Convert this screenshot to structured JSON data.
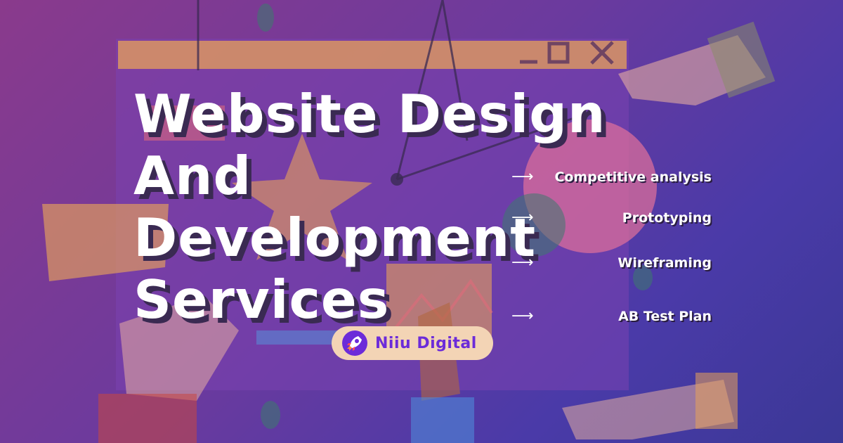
{
  "hero": {
    "title_lines": [
      "Website Design",
      "And",
      "Development",
      "Services"
    ]
  },
  "services": {
    "arrow_icon": "right-arrow-icon",
    "items": [
      {
        "label": "Competitive analysis"
      },
      {
        "label": "Prototyping"
      },
      {
        "label": "Wireframing"
      },
      {
        "label": "AB Test Plan"
      }
    ]
  },
  "brand": {
    "name": "Niiu Digital",
    "logo_icon": "rocket-icon",
    "accent_color": "#6c2bd9",
    "pill_color": "#f3d4b5"
  },
  "theme": {
    "background_start": "#8a3a8c",
    "background_end": "#3b3896",
    "title_color": "#ffffff",
    "shadow_color": "#3a2a52"
  }
}
